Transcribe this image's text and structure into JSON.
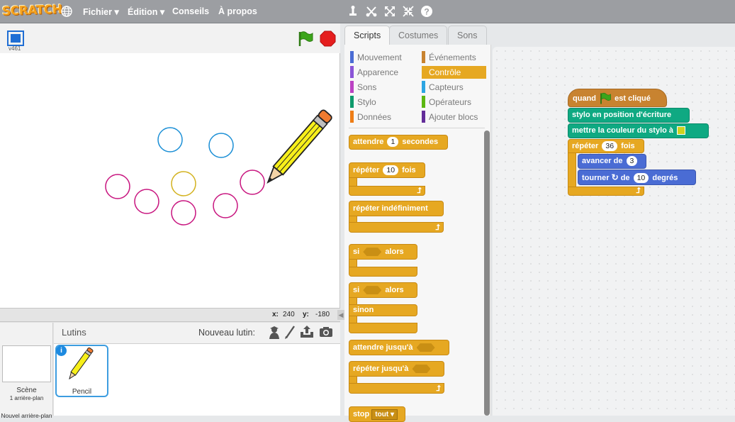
{
  "app": {
    "logo": "SCRATCH",
    "version": "v461"
  },
  "menu": {
    "file": "Fichier",
    "edit": "Édition",
    "tips": "Conseils",
    "about": "À propos"
  },
  "stage": {
    "x_label": "x:",
    "x_value": "240",
    "y_label": "y:",
    "y_value": "-180"
  },
  "sprites": {
    "title": "Lutins",
    "new_sprite": "Nouveau lutin:",
    "stage_name": "Scène",
    "stage_backdrops": "1 arrière-plan",
    "new_backdrop": "Nouvel arrière-plan",
    "selected_sprite": "Pencil",
    "info_badge": "i"
  },
  "tabs": [
    "Scripts",
    "Costumes",
    "Sons"
  ],
  "categories": {
    "left": [
      {
        "label": "Mouvement",
        "color": "#4a6cd4"
      },
      {
        "label": "Apparence",
        "color": "#8a55d7"
      },
      {
        "label": "Sons",
        "color": "#bb42c3"
      },
      {
        "label": "Stylo",
        "color": "#0e9a6c"
      },
      {
        "label": "Données",
        "color": "#ee7d16"
      }
    ],
    "right": [
      {
        "label": "Événements",
        "color": "#c88330"
      },
      {
        "label": "Contrôle",
        "color": "#e6a822"
      },
      {
        "label": "Capteurs",
        "color": "#2ca5e2"
      },
      {
        "label": "Opérateurs",
        "color": "#5cb712"
      },
      {
        "label": "Ajouter blocs",
        "color": "#632d99"
      }
    ]
  },
  "palette": {
    "wait": {
      "pre": "attendre",
      "val": "1",
      "post": "secondes"
    },
    "repeat": {
      "pre": "répéter",
      "val": "10",
      "post": "fois"
    },
    "forever": "répéter indéfiniment",
    "if_then": {
      "pre": "si",
      "post": "alors"
    },
    "if_else": {
      "pre": "si",
      "post": "alors",
      "else": "sinon"
    },
    "wait_until": "attendre jusqu'à",
    "repeat_until": "répéter jusqu'à",
    "stop": {
      "pre": "stop",
      "val": "tout"
    }
  },
  "script": {
    "hat": {
      "pre": "quand",
      "post": "est cliqué"
    },
    "pen_down": "stylo en position d'écriture",
    "set_color": "mettre la couleur du stylo à",
    "repeat": {
      "pre": "répéter",
      "val": "36",
      "post": "fois"
    },
    "move": {
      "pre": "avancer de",
      "val": "3"
    },
    "turn": {
      "pre": "tourner",
      "mid": "de",
      "val": "10",
      "post": "degrés"
    }
  },
  "colors": {
    "cyan": "#1b8fd6",
    "magenta": "#c8157f",
    "gold": "#d3b21f",
    "pen_swatch": "#cdd21f"
  }
}
